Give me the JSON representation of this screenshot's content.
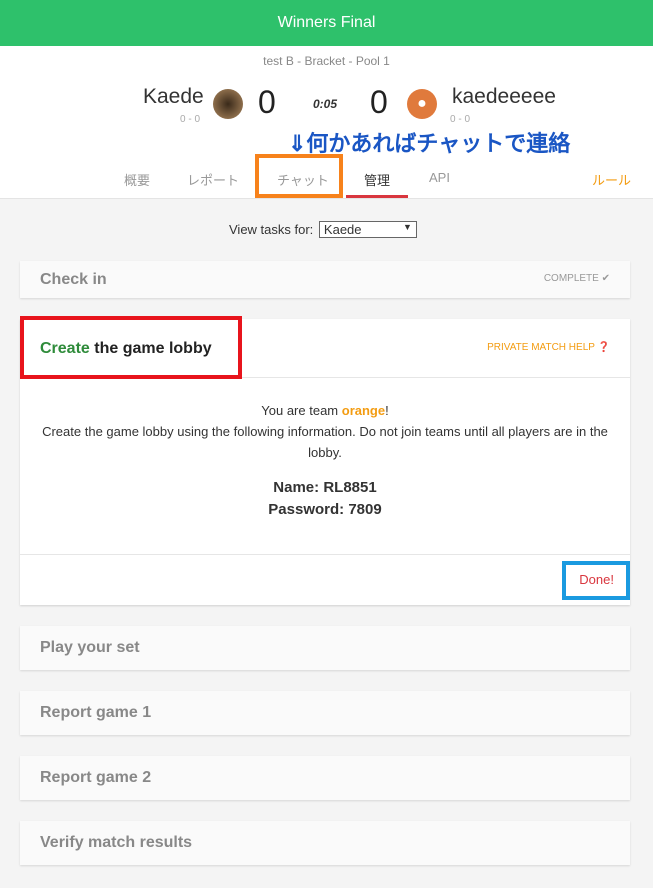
{
  "title": "Winners Final",
  "subtitle": "test B - Bracket - Pool 1",
  "player1": {
    "name": "Kaede",
    "record": "0 - 0",
    "score": "0"
  },
  "player2": {
    "name": "kaedeeeee",
    "record": "0 - 0",
    "score": "0"
  },
  "timer": "0:05",
  "annotation": "⇓何かあればチャットで連絡",
  "tabs": [
    "概要",
    "レポート",
    "チャット",
    "管理",
    "API"
  ],
  "rules": "ルール",
  "view_tasks_label": "View tasks for:",
  "view_tasks_value": "Kaede",
  "checkin": {
    "title": "Check in",
    "status": "COMPLETE"
  },
  "lobby": {
    "title_green": "Create",
    "title_rest": " the game lobby",
    "help": "PRIVATE MATCH HELP",
    "team_prefix": "You are team ",
    "team": "orange",
    "team_suffix": "!",
    "instructions": "Create the game lobby using the following information. Do not join teams until all players are in the lobby.",
    "name_label": "Name: ",
    "name": "RL8851",
    "password_label": "Password: ",
    "password": "7809",
    "done": "Done!"
  },
  "tasks": [
    "Play your set",
    "Report game 1",
    "Report game 2",
    "Verify match results"
  ],
  "colors": {
    "green": "#2ec16b",
    "orange": "#f39c12",
    "annotation": "#1a56c4"
  }
}
